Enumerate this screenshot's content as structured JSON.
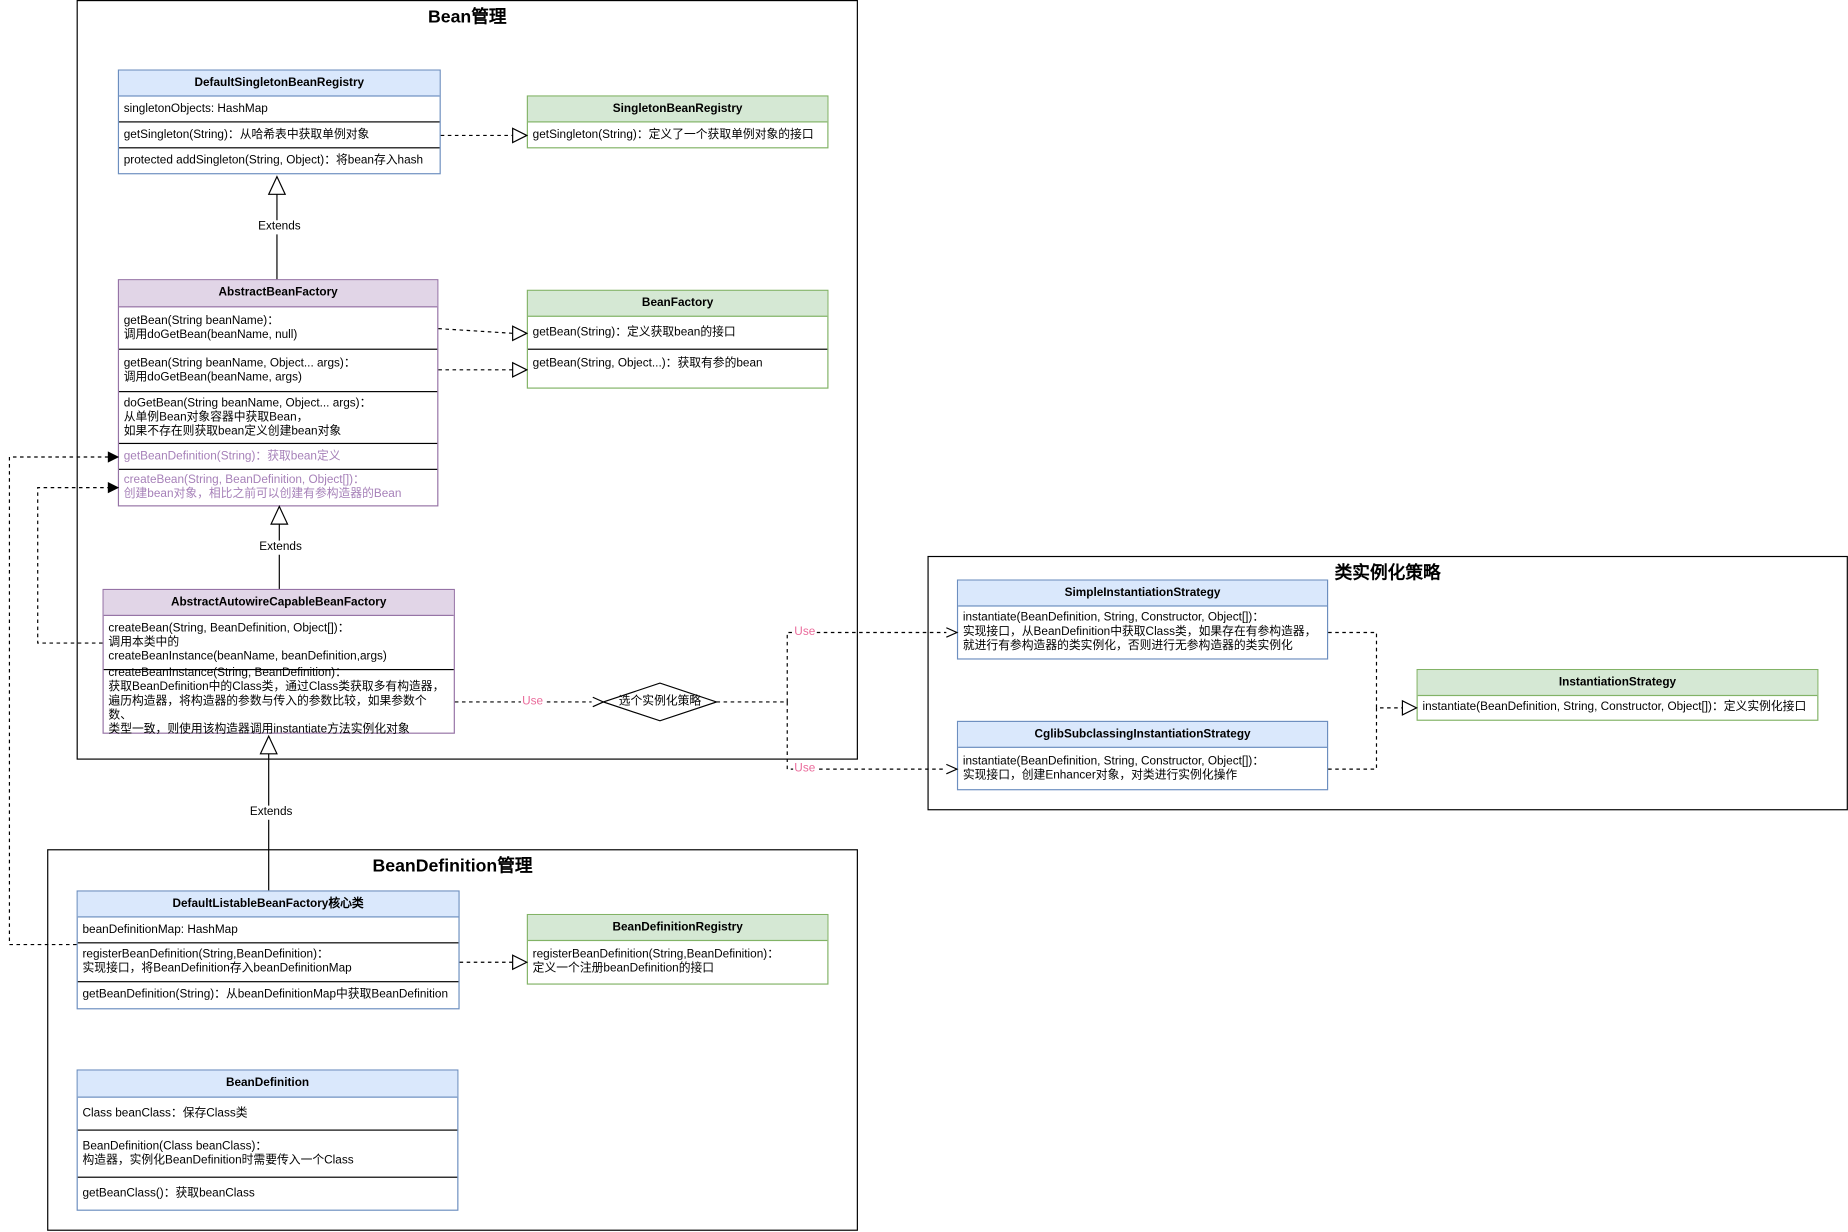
{
  "frames": {
    "bean": {
      "title": "Bean管理"
    },
    "beandef": {
      "title": "BeanDefinition管理"
    },
    "strategy": {
      "title": "类实例化策略"
    }
  },
  "classes": {
    "default_singleton": {
      "name": "DefaultSingletonBeanRegistry",
      "rows": [
        "singletonObjects: HashMap",
        "getSingleton(String)：从哈希表中获取单例对象",
        "protected addSingleton(String, Object)：将bean存入hash"
      ]
    },
    "singleton_registry": {
      "name": "SingletonBeanRegistry",
      "rows": [
        "getSingleton(String)：定义了一个获取单例对象的接口"
      ]
    },
    "abstract_bean_factory": {
      "name": "AbstractBeanFactory",
      "rows": [
        "getBean(String beanName)：\n调用doGetBean(beanName, null)",
        "getBean(String beanName, Object... args)：\n调用doGetBean(beanName, args)",
        "doGetBean(String beanName, Object... args)：\n从单例Bean对象容器中获取Bean，\n如果不存在则获取bean定义创建bean对象",
        "getBeanDefinition(String)：获取bean定义",
        "createBean(String, BeanDefinition, Object[])：\n创建bean对象，相比之前可以创建有参构造器的Bean"
      ]
    },
    "bean_factory": {
      "name": "BeanFactory",
      "rows": [
        "getBean(String)：定义获取bean的接口",
        "getBean(String, Object...)：获取有参的bean"
      ]
    },
    "abstract_autowire": {
      "name": "AbstractAutowireCapableBeanFactory",
      "rows": [
        "createBean(String, BeanDefinition, Object[])：\n调用本类中的\ncreateBeanInstance(beanName, beanDefinition,args)",
        "createBeanInstance(String, BeanDefinition)：\n获取BeanDefinition中的Class类，通过Class类获取多有构造器，\n遍历构造器，将构造器的参数与传入的参数比较，如果参数个数、\n类型一致，则使用该构造器调用instantiate方法实例化对象"
      ]
    },
    "simple_strategy": {
      "name": "SimpleInstantiationStrategy",
      "rows": [
        "instantiate(BeanDefinition, String, Constructor, Object[])：\n实现接口，从BeanDefinition中获取Class类，如果存在有参构造器，\n就进行有参构造器的类实例化，否则进行无参构造器的类实例化"
      ]
    },
    "cglib_strategy": {
      "name": "CglibSubclassingInstantiationStrategy",
      "rows": [
        "instantiate(BeanDefinition, String, Constructor, Object[])：\n实现接口，创建Enhancer对象，对类进行实例化操作"
      ]
    },
    "instantiation_strategy": {
      "name": "InstantiationStrategy",
      "rows": [
        "instantiate(BeanDefinition, String, Constructor, Object[])：定义实例化接口"
      ]
    },
    "default_listable": {
      "name": "DefaultListableBeanFactory核心类",
      "rows": [
        "beanDefinitionMap: HashMap",
        "registerBeanDefinition(String,BeanDefinition)：\n实现接口，将BeanDefinition存入beanDefinitionMap",
        "getBeanDefinition(String)：从beanDefinitionMap中获取BeanDefinition"
      ]
    },
    "bean_definition_registry": {
      "name": "BeanDefinitionRegistry",
      "rows": [
        "registerBeanDefinition(String,BeanDefinition)：\n定义一个注册beanDefinition的接口"
      ]
    },
    "bean_definition": {
      "name": "BeanDefinition",
      "rows": [
        "Class beanClass：保存Class类",
        "BeanDefinition(Class beanClass)：\n构造器，实例化BeanDefinition时需要传入一个Class",
        "getBeanClass()：获取beanClass"
      ]
    }
  },
  "labels": {
    "extends": "Extends",
    "use": "Use",
    "choose_strategy": "选个实例化策略"
  }
}
